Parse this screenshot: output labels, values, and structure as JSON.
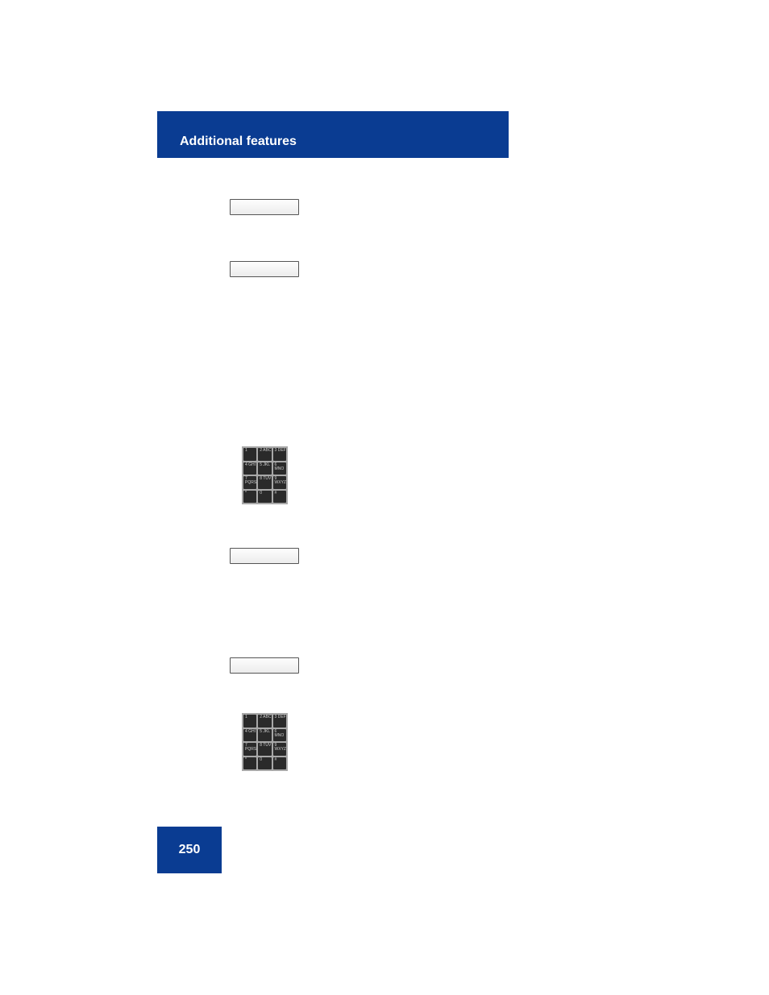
{
  "header": {
    "title": "Additional features"
  },
  "footer": {
    "page_number": "250"
  },
  "keypad_labels": [
    "1",
    "2 ABC",
    "3 DEF",
    "4 GHI",
    "5 JKL",
    "6 MNO",
    "7 PQRS",
    "8 TUV",
    "9 WXYZ",
    "*",
    "0",
    "#"
  ]
}
